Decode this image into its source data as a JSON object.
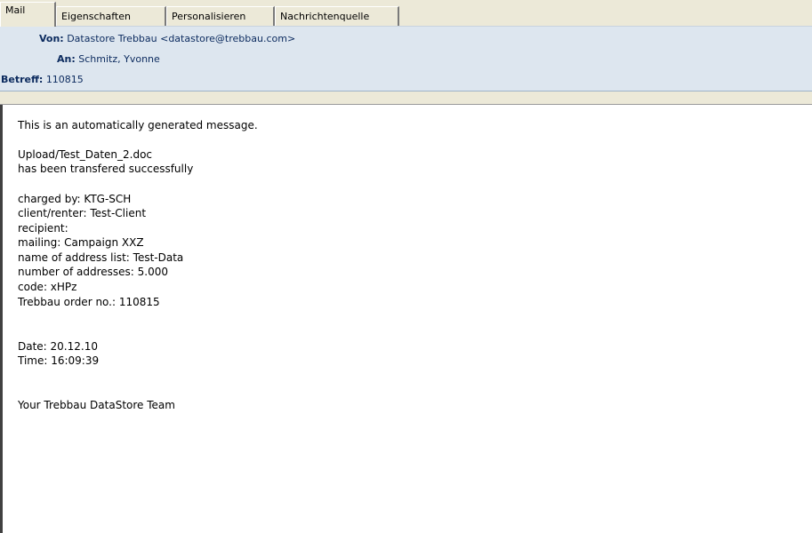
{
  "tabs": [
    {
      "label": "Mail",
      "active": true
    },
    {
      "label": "Eigenschaften",
      "active": false
    },
    {
      "label": "Personalisieren",
      "active": false
    },
    {
      "label": "Nachrichtenquelle",
      "active": false
    }
  ],
  "header": {
    "from_label": "Von:",
    "from_value": "Datastore Trebbau <datastore@trebbau.com>",
    "to_label": "An:",
    "to_value": "Schmitz, Yvonne",
    "subject_label": "Betreff:",
    "subject_value": "110815"
  },
  "body": {
    "lines": [
      "This is an automatically generated message.",
      "Upload/Test_Daten_2.doc",
      "has been transfered successfully",
      "charged by: KTG-SCH",
      "client/renter: Test-Client",
      "recipient:",
      "mailing: Campaign XXZ",
      "name of address list: Test-Data",
      "number of addresses: 5.000",
      "code: xHPz",
      "Trebbau order no.: 110815",
      "Date: 20.12.10",
      "Time: 16:09:39",
      "Your Trebbau DataStore Team"
    ]
  }
}
